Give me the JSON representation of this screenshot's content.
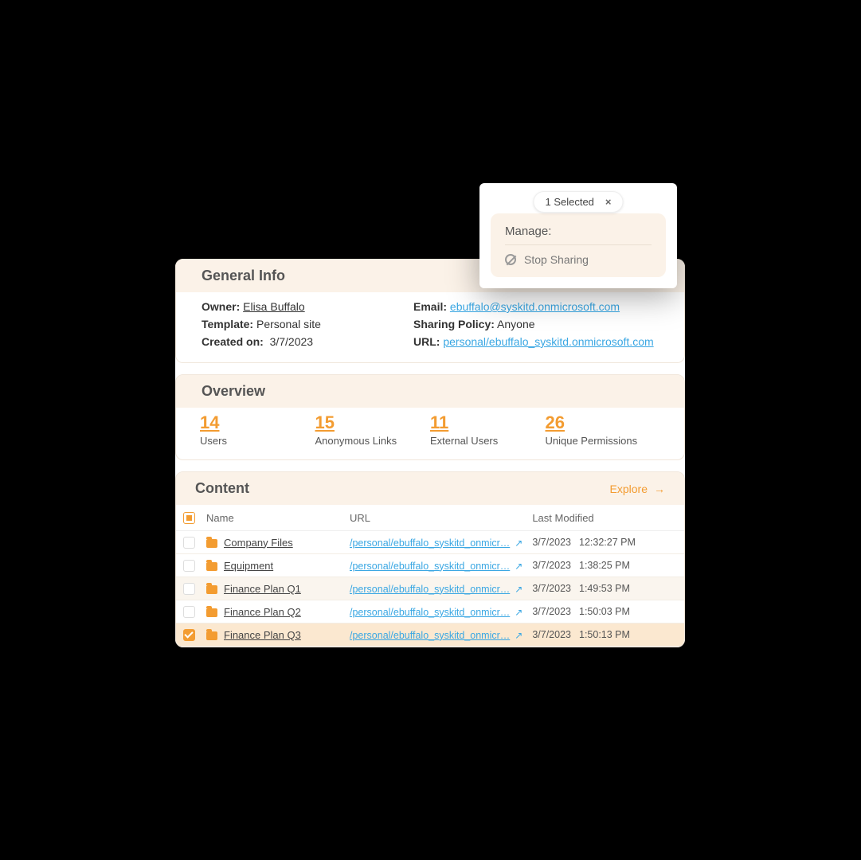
{
  "selection": {
    "count_text": "1 Selected",
    "manage_title": "Manage:",
    "stop_sharing": "Stop Sharing"
  },
  "general": {
    "title": "General Info",
    "owner_label": "Owner:",
    "owner_value": "Elisa Buffalo",
    "template_label": "Template:",
    "template_value": "Personal site",
    "created_label": "Created on:",
    "created_value": "3/7/2023",
    "email_label": "Email:",
    "email_value": "ebuffalo@syskitd.onmicrosoft.com",
    "policy_label": "Sharing Policy:",
    "policy_value": "Anyone",
    "url_label": "URL:",
    "url_value": "personal/ebuffalo_syskitd.onmicrosoft.com"
  },
  "overview": {
    "title": "Overview",
    "metrics": [
      {
        "value": "14",
        "label": "Users"
      },
      {
        "value": "15",
        "label": "Anonymous Links"
      },
      {
        "value": "11",
        "label": "External Users"
      },
      {
        "value": "26",
        "label": "Unique Permissions"
      }
    ]
  },
  "content": {
    "title": "Content",
    "explore": "Explore",
    "columns": {
      "name": "Name",
      "url": "URL",
      "modified": "Last Modified"
    },
    "url_display": "/personal/ebuffalo_syskitd_onmicr…",
    "rows": [
      {
        "name": "Company Files",
        "date": "3/7/2023",
        "time": "12:32:27 PM",
        "selected": false,
        "alt": false
      },
      {
        "name": "Equipment",
        "date": "3/7/2023",
        "time": "1:38:25 PM",
        "selected": false,
        "alt": false
      },
      {
        "name": "Finance Plan Q1",
        "date": "3/7/2023",
        "time": "1:49:53 PM",
        "selected": false,
        "alt": true
      },
      {
        "name": "Finance Plan Q2",
        "date": "3/7/2023",
        "time": "1:50:03 PM",
        "selected": false,
        "alt": false
      },
      {
        "name": "Finance Plan Q3",
        "date": "3/7/2023",
        "time": "1:50:13 PM",
        "selected": true,
        "alt": false
      }
    ]
  }
}
